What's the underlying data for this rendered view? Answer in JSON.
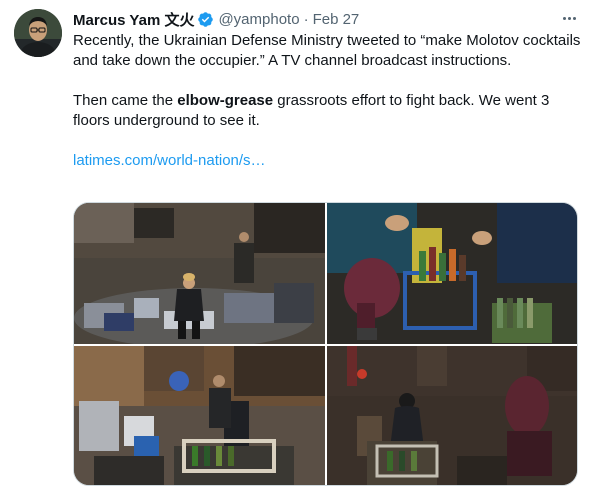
{
  "author": {
    "display_name": "Marcus Yam 文火",
    "handle": "@yamphoto",
    "separator": "·",
    "date": "Feb 27",
    "verified": true
  },
  "tweet": {
    "para1": "Recently, the Ukrainian Defense Ministry tweeted to “make Molotov cocktails and take down the occupier.” A TV channel broadcast instructions.",
    "para2_before": "Then came the ",
    "para2_bold": "elbow-grease",
    "para2_after": " grassroots effort to fight back. We went 3 floors underground to see it.",
    "link": "latimes.com/world-nation/s…"
  },
  "icons": {
    "verified": "verified-badge-icon",
    "more": "more-options-icon"
  },
  "colors": {
    "link": "#1d9bf0",
    "secondary_text": "#536471",
    "verified": "#1d9bf0"
  },
  "media": {
    "photo_count": 4
  }
}
